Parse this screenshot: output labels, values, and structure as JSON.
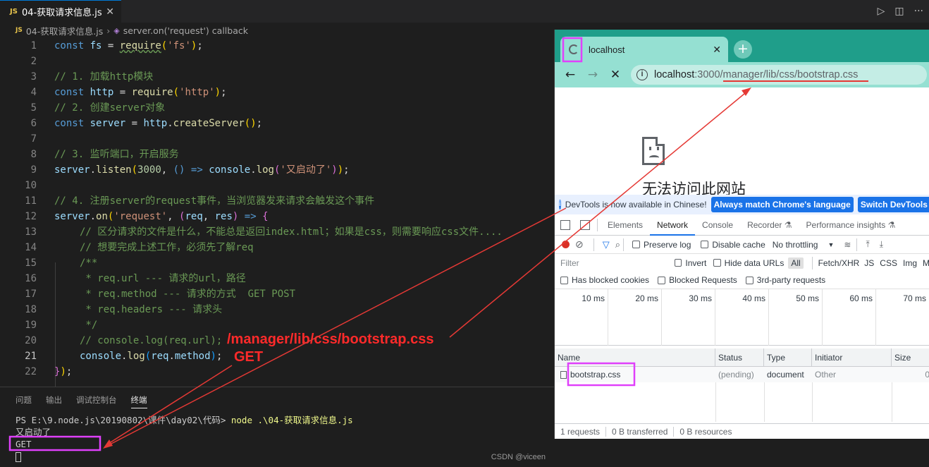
{
  "editor": {
    "tab": {
      "badge": "JS",
      "title": "04-获取请求信息.js",
      "close": "✕"
    },
    "actions": {
      "run": "▷",
      "split": "◫",
      "more": "···"
    },
    "breadcrumb": {
      "badge": "JS",
      "file": "04-获取请求信息.js",
      "symbol": "server.on('request') callback"
    },
    "active_line": 21,
    "lines": [
      {
        "n": "1"
      },
      {
        "n": "2"
      },
      {
        "n": "3"
      },
      {
        "n": "4"
      },
      {
        "n": "5"
      },
      {
        "n": "6"
      },
      {
        "n": "7"
      },
      {
        "n": "8"
      },
      {
        "n": "9"
      },
      {
        "n": "10"
      },
      {
        "n": "11"
      },
      {
        "n": "12"
      },
      {
        "n": "13"
      },
      {
        "n": "14"
      },
      {
        "n": "15"
      },
      {
        "n": "16"
      },
      {
        "n": "17"
      },
      {
        "n": "18"
      },
      {
        "n": "19"
      },
      {
        "n": "20"
      },
      {
        "n": "21"
      },
      {
        "n": "22"
      }
    ],
    "code": {
      "l1_const": "const",
      "l1_var": "fs",
      "l1_eq": " = ",
      "l1_fn": "require",
      "l1_str": "'fs'",
      "l1_end": ");",
      "l3": "// 1. 加载http模块",
      "l4_const": "const",
      "l4_var": "http",
      "l4_fn": "require",
      "l4_str": "'http'",
      "l5": "// 2. 创建server对象",
      "l6_const": "const",
      "l6_var": "server",
      "l6_obj": "http",
      "l6_fn": "createServer",
      "l8": "// 3. 监听端口，开启服务",
      "l9_obj": "server",
      "l9_fn": "listen",
      "l9_num": "3000",
      "l9_arrow": "() =>",
      "l9_console": "console",
      "l9_log": "log",
      "l9_str": "'又启动了'",
      "l11": "// 4. 注册server的request事件，当浏览器发来请求会触发这个事件",
      "l12_obj": "server",
      "l12_fn": "on",
      "l12_str": "'request'",
      "l12_p1": "req",
      "l12_p2": "res",
      "l12_arrow": "=>",
      "l13": "// 区分请求的文件是什么，不能总是返回index.html；如果是css，则需要响应css文件....",
      "l14": "// 想要完成上述工作，必须先了解req",
      "l15": "/**",
      "l16": " * req.url --- 请求的url，路径",
      "l17": " * req.method --- 请求的方式  GET POST",
      "l18": " * req.headers --- 请求头",
      "l19": " */",
      "l20": "// console.log(req.url);",
      "l21_console": "console",
      "l21_log": "log",
      "l21_req": "req",
      "l21_method": "method",
      "l22": "});"
    },
    "annotations": {
      "url_output": "/manager/lib/css/bootstrap.css",
      "method_output": "GET"
    }
  },
  "panel": {
    "tabs": [
      "问题",
      "输出",
      "调试控制台",
      "终端"
    ],
    "active_tab": "终端",
    "terminal": {
      "prompt": "PS E:\\9.node.js\\20190802\\课件\\day02\\代码> ",
      "command": "node .\\04-获取请求信息.js",
      "line2": "又启动了",
      "line3": "GET"
    },
    "watermark": "CSDN @viceen"
  },
  "browser": {
    "tab_title": "localhost",
    "tab_close": "✕",
    "new_tab": "+",
    "nav": {
      "back": "←",
      "forward": "→",
      "stop": "✕"
    },
    "url_host": "localhost",
    "url_rest": ":3000/manager/lib/css/bootstrap.css",
    "error_title": "无法访问此网站",
    "devtools": {
      "banner_text": "DevTools is now available in Chinese!",
      "banner_btn1": "Always match Chrome's language",
      "banner_btn2": "Switch DevTools to",
      "tabs": [
        "Elements",
        "Network",
        "Console",
        "Recorder ⚗",
        "Performance insights ⚗"
      ],
      "active_tab": "Network",
      "preserve_log": "Preserve log",
      "disable_cache": "Disable cache",
      "throttling": "No throttling",
      "filter_placeholder": "Filter",
      "invert": "Invert",
      "hide_data_urls": "Hide data URLs",
      "type_all": "All",
      "types": [
        "Fetch/XHR",
        "JS",
        "CSS",
        "Img",
        "M"
      ],
      "has_blocked_cookies": "Has blocked cookies",
      "blocked_requests": "Blocked Requests",
      "third_party": "3rd-party requests",
      "timeline_ticks": [
        "10 ms",
        "20 ms",
        "30 ms",
        "40 ms",
        "50 ms",
        "60 ms",
        "70 ms"
      ],
      "columns": [
        "Name",
        "Status",
        "Type",
        "Initiator",
        "Size"
      ],
      "row": {
        "name": "bootstrap.css",
        "status": "(pending)",
        "type": "document",
        "initiator": "Other",
        "size": "0"
      },
      "status_bar": [
        "1 requests",
        "0 B transferred",
        "0 B resources"
      ]
    }
  },
  "colors": {
    "annotation_red": "#ff2a2a",
    "highlight_magenta": "#e040fb",
    "browser_theme": "#1f9e8a"
  }
}
